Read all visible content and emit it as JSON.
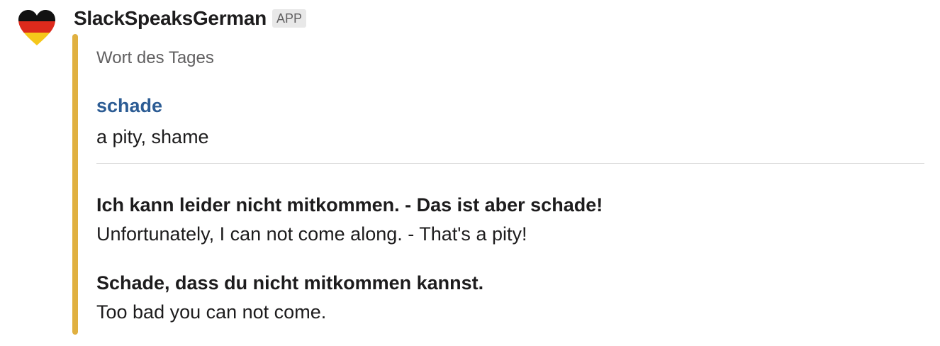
{
  "message": {
    "sender": "SlackSpeaksGerman",
    "badge": "APP",
    "avatar_icon": "german-flag-heart-icon",
    "attachment_color": "#e0b040",
    "attachment": {
      "pretext": "Wort des Tages",
      "word": "schade",
      "translation": "a pity, shame",
      "examples": [
        {
          "german": "Ich kann leider nicht mitkommen. - Das ist aber schade!",
          "english": "Unfortunately, I can not come along. - That's a pity!"
        },
        {
          "german": "Schade, dass du nicht mitkommen kannst.",
          "english": "Too bad you can not come."
        }
      ]
    }
  }
}
